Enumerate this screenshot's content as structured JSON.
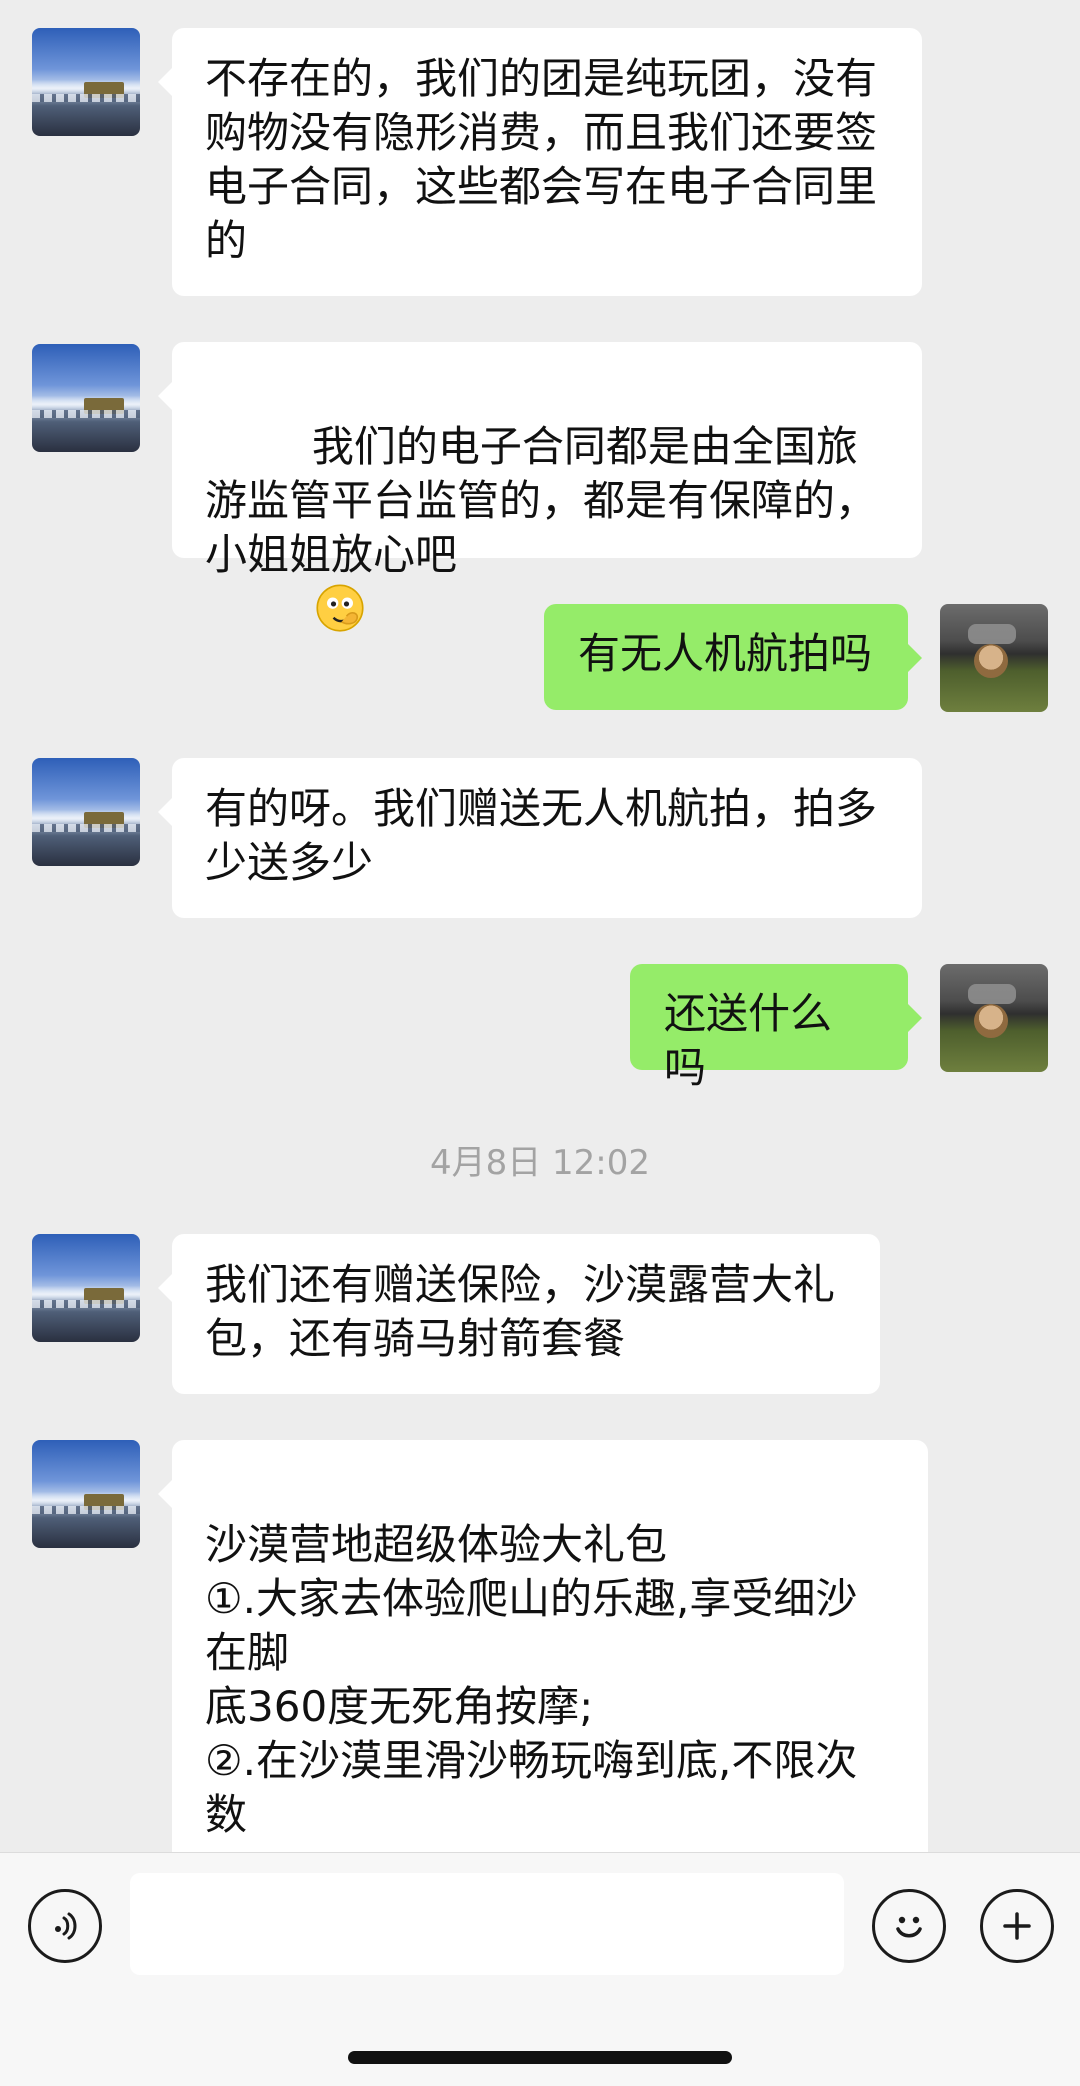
{
  "messages": [
    {
      "side": "incoming",
      "text": "不存在的，我们的团是纯玩团，没有购物没有隐形消费，而且我们还要签电子合同，这些都会写在电子合同里的"
    },
    {
      "side": "incoming",
      "text": "我们的电子合同都是由全国旅游监管平台监管的，都是有保障的，小姐姐放心吧",
      "emoji": "face-with-hand-over-mouth-emoji"
    },
    {
      "side": "outgoing",
      "text": "有无人机航拍吗"
    },
    {
      "side": "incoming",
      "text": "有的呀。我们赠送无人机航拍，拍多少送多少"
    },
    {
      "side": "outgoing",
      "text": "还送什么吗"
    },
    {
      "side": "incoming",
      "text": "我们还有赠送保险，沙漠露营大礼包，还有骑马射箭套餐"
    },
    {
      "side": "incoming",
      "text": "\n沙漠营地超级体验大礼包\n①.大家去体验爬山的乐趣,享受细沙在脚\n底360度无死角按摩;\n②.在沙漠里滑沙畅玩嗨到底,不限次数"
    }
  ],
  "timestamp": "4月8日 12:02",
  "input": {
    "value": "",
    "placeholder": ""
  },
  "icons": {
    "voice": "voice-icon",
    "emoji": "emoji-icon",
    "plus": "plus-icon"
  },
  "colors": {
    "background": "#ededed",
    "incoming_bubble": "#ffffff",
    "outgoing_bubble": "#95ec69",
    "timestamp": "#a3a3a3"
  }
}
